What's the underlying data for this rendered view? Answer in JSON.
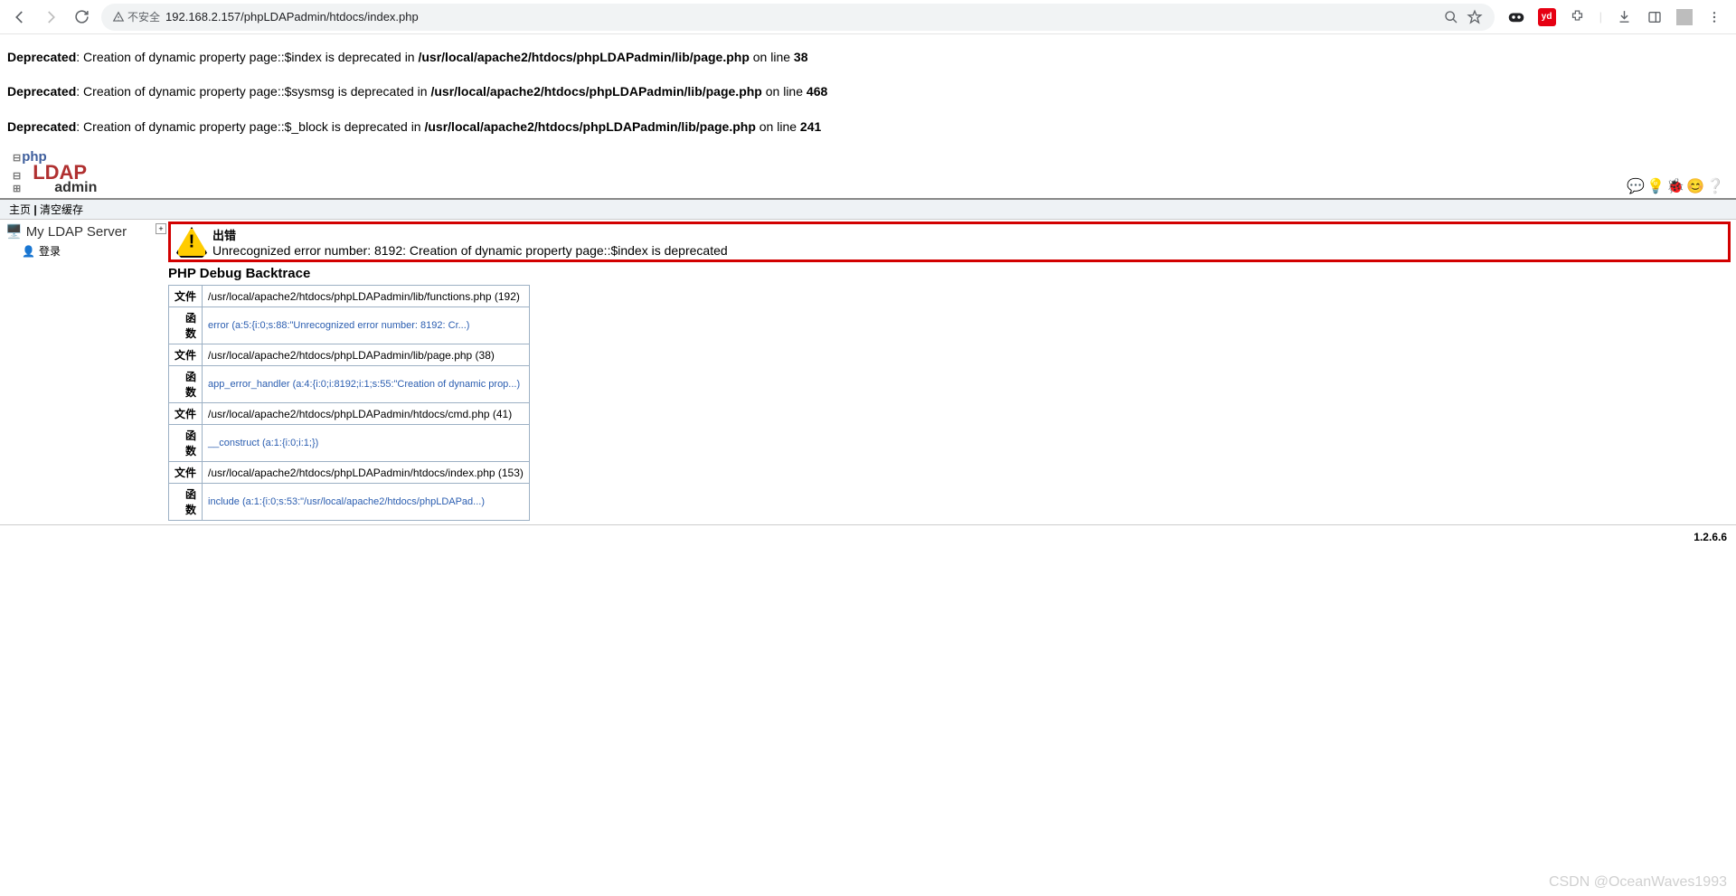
{
  "browser": {
    "url": "192.168.2.157/phpLDAPadmin/htdocs/index.php",
    "insecure_label": "不安全"
  },
  "deprecated": [
    {
      "prefix": "Deprecated",
      "text": ": Creation of dynamic property page::$index is deprecated in ",
      "file": "/usr/local/apache2/htdocs/phpLDAPadmin/lib/page.php",
      "on": " on line ",
      "line": "38"
    },
    {
      "prefix": "Deprecated",
      "text": ": Creation of dynamic property page::$sysmsg is deprecated in ",
      "file": "/usr/local/apache2/htdocs/phpLDAPadmin/lib/page.php",
      "on": " on line ",
      "line": "468"
    },
    {
      "prefix": "Deprecated",
      "text": ": Creation of dynamic property page::$_block is deprecated in ",
      "file": "/usr/local/apache2/htdocs/phpLDAPadmin/lib/page.php",
      "on": " on line ",
      "line": "241"
    }
  ],
  "linkbar": {
    "home": "主页",
    "sep": " | ",
    "purge": "清空缓存"
  },
  "sidebar": {
    "server": "My LDAP Server",
    "login": "登录"
  },
  "error": {
    "title": "出错",
    "message": "Unrecognized error number: 8192: Creation of dynamic property page::$index is deprecated"
  },
  "backtrace": {
    "header": "PHP Debug Backtrace",
    "file_label": "文件",
    "func_label": "函数",
    "rows": [
      {
        "file": "/usr/local/apache2/htdocs/phpLDAPadmin/lib/functions.php (192)",
        "fn": "error",
        "args": "(a:5:{i:0;s:88:\"Unrecognized error number: 8192: Cr...)"
      },
      {
        "file": "/usr/local/apache2/htdocs/phpLDAPadmin/lib/page.php (38)",
        "fn": "app_error_handler",
        "args": "(a:4:{i:0;i:8192;i:1;s:55:\"Creation of dynamic prop...)"
      },
      {
        "file": "/usr/local/apache2/htdocs/phpLDAPadmin/htdocs/cmd.php (41)",
        "fn": "__construct",
        "args": "(a:1:{i:0;i:1;})"
      },
      {
        "file": "/usr/local/apache2/htdocs/phpLDAPadmin/htdocs/index.php (153)",
        "fn": "include",
        "args": "(a:1:{i:0;s:53:\"/usr/local/apache2/htdocs/phpLDAPad...)"
      }
    ]
  },
  "version": "1.2.6.6",
  "watermark": "CSDN @OceanWaves1993"
}
